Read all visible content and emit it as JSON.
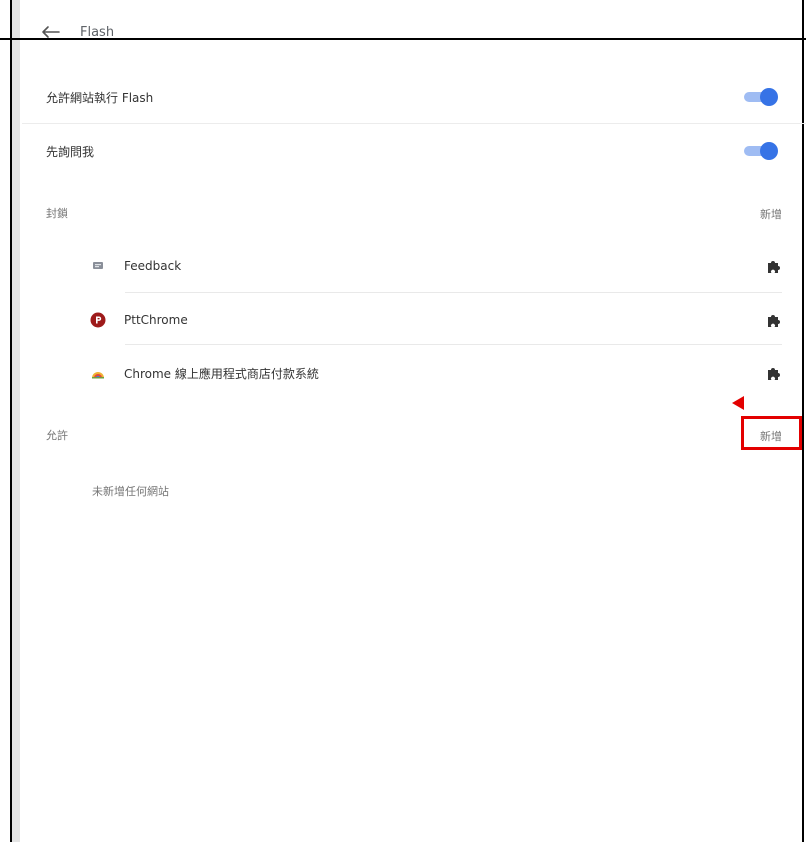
{
  "header": {
    "title": "Flash"
  },
  "settings": {
    "allow_flash": {
      "label": "允許網站執行 Flash",
      "enabled": true
    },
    "ask_first": {
      "label": "先詢問我",
      "enabled": true
    }
  },
  "blocked": {
    "label": "封鎖",
    "add_label": "新增",
    "items": [
      {
        "name": "Feedback",
        "icon": "feedback-icon"
      },
      {
        "name": "PttChrome",
        "icon": "pttchrome-icon"
      },
      {
        "name": "Chrome 線上應用程式商店付款系統",
        "icon": "chrome-webstore-payments-icon"
      }
    ]
  },
  "allowed": {
    "label": "允許",
    "add_label": "新增",
    "empty_text": "未新增任何網站"
  },
  "colors": {
    "toggle_knob": "#3673e6",
    "toggle_track": "#9fbcf3",
    "highlight": "#e30000"
  }
}
